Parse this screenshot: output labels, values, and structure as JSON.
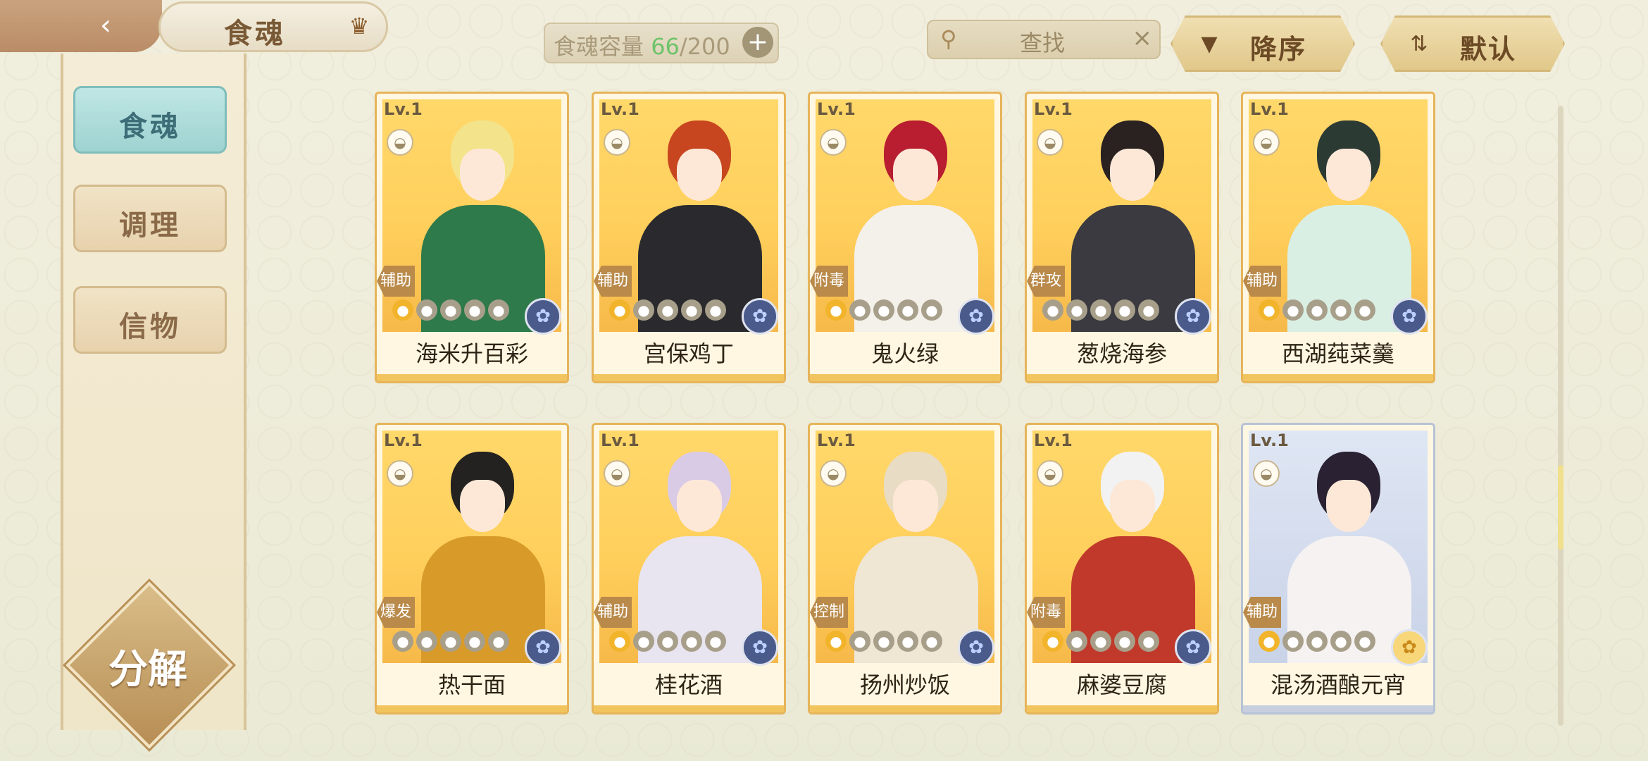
{
  "header": {
    "title": "食魂"
  },
  "capacity": {
    "label": "食魂容量",
    "current": "66",
    "sep": "/",
    "max": "200",
    "plus": "+"
  },
  "search": {
    "label": "查找",
    "clear": "×"
  },
  "sort": {
    "order_label": "降序",
    "mode_label": "默认"
  },
  "sidebar": {
    "items": [
      {
        "label": "食魂",
        "active": true
      },
      {
        "label": "调理",
        "active": false
      },
      {
        "label": "信物",
        "active": false
      }
    ]
  },
  "decompose": {
    "label": "分解"
  },
  "cards": [
    {
      "level": "Lv.1",
      "tag": "辅助",
      "name": "海米升百彩",
      "stars_on": 1,
      "hair": "#f3e38b",
      "outfit": "#2f7a4a",
      "frame": "gold"
    },
    {
      "level": "Lv.1",
      "tag": "辅助",
      "name": "宫保鸡丁",
      "stars_on": 1,
      "hair": "#c8461f",
      "outfit": "#2a2a2e",
      "frame": "gold"
    },
    {
      "level": "Lv.1",
      "tag": "附毒",
      "name": "鬼火绿",
      "stars_on": 1,
      "hair": "#b81d30",
      "outfit": "#f4f0ea",
      "frame": "gold"
    },
    {
      "level": "Lv.1",
      "tag": "群攻",
      "name": "葱烧海参",
      "stars_on": 0,
      "hair": "#2a2220",
      "outfit": "#3a3a40",
      "frame": "gold"
    },
    {
      "level": "Lv.1",
      "tag": "辅助",
      "name": "西湖莼菜羹",
      "stars_on": 1,
      "hair": "#2c3a34",
      "outfit": "#d9efe4",
      "frame": "gold"
    },
    {
      "level": "Lv.1",
      "tag": "爆发",
      "name": "热干面",
      "stars_on": 0,
      "hair": "#242220",
      "outfit": "#d89b2a",
      "frame": "gold"
    },
    {
      "level": "Lv.1",
      "tag": "辅助",
      "name": "桂花酒",
      "stars_on": 1,
      "hair": "#d9cbe6",
      "outfit": "#e8e4f0",
      "frame": "gold"
    },
    {
      "level": "Lv.1",
      "tag": "控制",
      "name": "扬州炒饭",
      "stars_on": 1,
      "hair": "#e9dcc4",
      "outfit": "#efe6d4",
      "frame": "gold"
    },
    {
      "level": "Lv.1",
      "tag": "附毒",
      "name": "麻婆豆腐",
      "stars_on": 1,
      "hair": "#f2f2f2",
      "outfit": "#c0392b",
      "frame": "gold"
    },
    {
      "level": "Lv.1",
      "tag": "辅助",
      "name": "混汤酒酿元宵",
      "stars_on": 1,
      "hair": "#2a2232",
      "outfit": "#f6f2f2",
      "frame": "blue"
    }
  ]
}
